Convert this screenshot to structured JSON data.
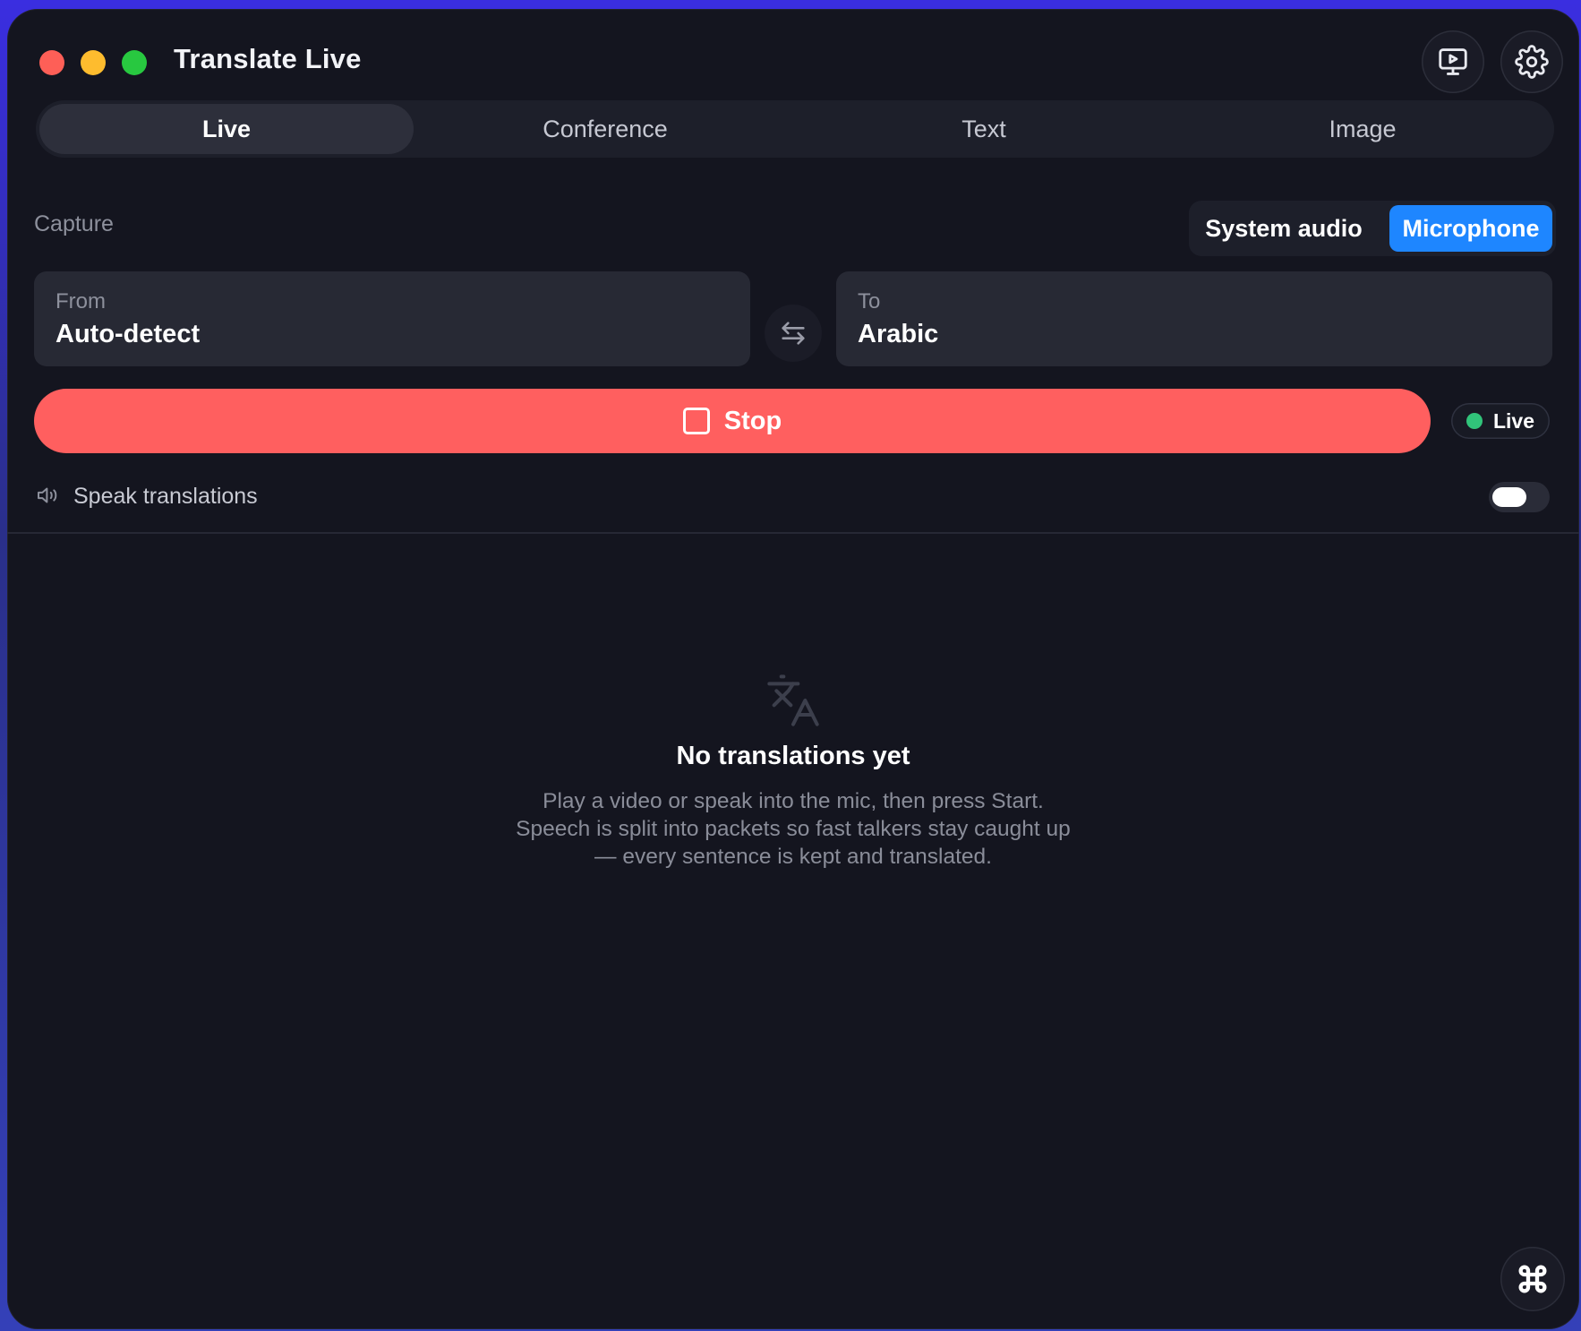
{
  "window": {
    "title": "Translate Live"
  },
  "toolbar": {
    "present_icon": "screen-play-icon",
    "settings_icon": "gear-icon"
  },
  "tabs": [
    {
      "label": "Live",
      "active": true
    },
    {
      "label": "Conference",
      "active": false
    },
    {
      "label": "Text",
      "active": false
    },
    {
      "label": "Image",
      "active": false
    }
  ],
  "capture": {
    "label": "Capture",
    "options": [
      {
        "label": "System audio",
        "selected": false
      },
      {
        "label": "Microphone",
        "selected": true
      }
    ]
  },
  "languages": {
    "from_label": "From",
    "from_value": "Auto-detect",
    "to_label": "To",
    "to_value": "Arabic",
    "swap_icon": "swap-arrows-icon"
  },
  "controls": {
    "stop_label": "Stop",
    "live_badge": "Live",
    "speak_label": "Speak translations",
    "speak_enabled": false
  },
  "empty_state": {
    "title": "No translations yet",
    "body": "Play a video or speak into the mic, then press Start. Speech is split into packets so fast talkers stay caught up — every sentence is kept and translated."
  },
  "colors": {
    "accent": "#1e86ff",
    "stop": "#ff5f5f",
    "live_dot": "#31c47a"
  }
}
